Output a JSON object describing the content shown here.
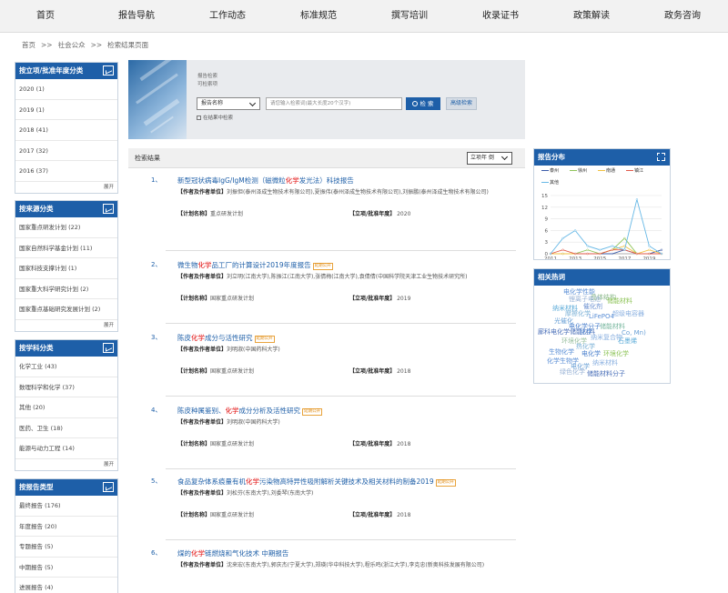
{
  "nav": [
    "首页",
    "报告导航",
    "工作动态",
    "标准规范",
    "撰写培训",
    "收录证书",
    "政策解读",
    "政务咨询"
  ],
  "breadcrumb": [
    "首页",
    ">>",
    "社会公众",
    ">>",
    "检索结果页面"
  ],
  "sidebar": [
    {
      "title": "按立项/批准年度分类",
      "items": [
        "2020 (1)",
        "2019 (1)",
        "2018 (41)",
        "2017 (32)",
        "2016 (37)"
      ],
      "more": "展开"
    },
    {
      "title": "按来源分类",
      "items": [
        "国家重点研发计划 (22)",
        "国家自然科学基金计划 (11)",
        "国家科技支撑计划 (1)",
        "国家重大科学研究计划 (2)",
        "国家重点基础研究发展计划 (2)"
      ],
      "more": "展开"
    },
    {
      "title": "按学科分类",
      "items": [
        "化学工业 (43)",
        "数理科学和化学 (37)",
        "其他 (20)",
        "医药、卫生 (18)",
        "能源与动力工程 (14)"
      ],
      "more": "展开"
    },
    {
      "title": "按报告类型",
      "items": [
        "最终报告 (176)",
        "年度报告 (20)",
        "专题报告 (5)",
        "中期报告 (5)",
        "进展报告 (4)"
      ],
      "more": ""
    }
  ],
  "search": {
    "label1": "报告检索",
    "label2": "可检索项",
    "field_select": "报告名称",
    "placeholder": "请您输入检索词(最大长度20个汉字)",
    "search_button": "检 索",
    "advanced_button": "高级检索",
    "in_results": "在结果中检索"
  },
  "results_header": {
    "title": "检索结果",
    "sort": "立项年 倒"
  },
  "results": [
    {
      "num": "1、",
      "title_parts": [
        {
          "t": "新型冠状病毒IgG/IgM检测（磁微粒"
        },
        {
          "t": "化学",
          "hl": true
        },
        {
          "t": "发光法）科技报告"
        }
      ],
      "tag": "",
      "author_label": "【作者及作者单位】",
      "authors": "刘振但(泰州泽成生物技术有限公司),夏振伟(泰州泽成生物技术有限公司),刘振鹏(泰州泽成生物技术有限公司)",
      "plan_label": "【计划名称】",
      "plan": "重点研发计划",
      "year_label": "【立项/批准年度】",
      "year": "2020"
    },
    {
      "num": "2、",
      "title_parts": [
        {
          "t": "微生物"
        },
        {
          "t": "化学",
          "hl": true
        },
        {
          "t": "品工厂的计算设计2019年度报告"
        }
      ],
      "tag": "延期公开",
      "author_label": "【作者及作者单位】",
      "authors": "刘立明(江南大学),陈振江(江南大学),张倩梅(江南大学),袁倩倩(中国科学院天津工业生物技术研究所)",
      "plan_label": "【计划名称】",
      "plan": "国家重点研发计划",
      "year_label": "【立项/批准年度】",
      "year": "2019"
    },
    {
      "num": "3、",
      "title_parts": [
        {
          "t": "陈皮"
        },
        {
          "t": "化学",
          "hl": true
        },
        {
          "t": "成分与活性研究"
        }
      ],
      "tag": "延期公开",
      "author_label": "【作者及作者单位】",
      "authors": "刘明淑(中国药科大学)",
      "plan_label": "【计划名称】",
      "plan": "国家重点研发计划",
      "year_label": "【立项/批准年度】",
      "year": "2018"
    },
    {
      "num": "4、",
      "title_parts": [
        {
          "t": "陈皮种属鉴别、"
        },
        {
          "t": "化学",
          "hl": true
        },
        {
          "t": "成分分析及活性研究"
        }
      ],
      "tag": "延期公开",
      "author_label": "【作者及作者单位】",
      "authors": "刘明淑(中国药科大学)",
      "plan_label": "【计划名称】",
      "plan": "国家重点研发计划",
      "year_label": "【立项/批准年度】",
      "year": "2018"
    },
    {
      "num": "5、",
      "title_parts": [
        {
          "t": "食品复杂体系痕量有机"
        },
        {
          "t": "化学",
          "hl": true
        },
        {
          "t": "污染物高特异性吸附解析关键技术及相关材料的制备2019"
        }
      ],
      "tag": "延期公开",
      "author_label": "【作者及作者单位】",
      "authors": "刘松芬(东南大学),刘委琴(东南大学)",
      "plan_label": "【计划名称】",
      "plan": "国家重点研发计划",
      "year_label": "【立项/批准年度】",
      "year": "2018"
    },
    {
      "num": "6、",
      "title_parts": [
        {
          "t": "煤的"
        },
        {
          "t": "化学",
          "hl": true
        },
        {
          "t": "链燃烧和气化技术 中期报告"
        }
      ],
      "tag": "",
      "author_label": "【作者及作者单位】",
      "authors": "沈来宏(东南大学),郭庆杰(宁夏大学),郑瑛(华中科技大学),程乐鸣(浙江大学),李克忠(新奥科技发展有限公司)",
      "plan_label": "",
      "plan": "",
      "year_label": "",
      "year": ""
    }
  ],
  "report_dist": {
    "title": "报告分布",
    "legend": [
      {
        "name": "泰州",
        "color": "#3b5ba9"
      },
      {
        "name": "徐州",
        "color": "#8fc45a"
      },
      {
        "name": "南通",
        "color": "#f0c040"
      },
      {
        "name": "镇江",
        "color": "#e05a4a"
      },
      {
        "name": "其他",
        "color": "#66b8e6"
      }
    ]
  },
  "chart_data": {
    "type": "line",
    "x": [
      2011,
      2012,
      2013,
      2014,
      2015,
      2016,
      2017,
      2018,
      2019,
      2020
    ],
    "x_tick_labels": [
      "2011",
      "2013",
      "2015",
      "2017",
      "2019"
    ],
    "y_ticks": [
      0,
      3,
      6,
      9,
      12,
      15
    ],
    "ylim": [
      0,
      15
    ],
    "series": [
      {
        "name": "泰州",
        "color": "#3b5ba9",
        "values": [
          0,
          0,
          0,
          0,
          0,
          0,
          1,
          0,
          0,
          1
        ]
      },
      {
        "name": "徐州",
        "color": "#8fc45a",
        "values": [
          0,
          0,
          0,
          1,
          0,
          1,
          4,
          0,
          0,
          0
        ]
      },
      {
        "name": "南通",
        "color": "#f0c040",
        "values": [
          0,
          0,
          0,
          0,
          0,
          1,
          2,
          0,
          1,
          0
        ]
      },
      {
        "name": "镇江",
        "color": "#e05a4a",
        "values": [
          0,
          1,
          0,
          0,
          0,
          1,
          1,
          0,
          0,
          0
        ]
      },
      {
        "name": "其他",
        "color": "#66b8e6",
        "values": [
          0,
          4,
          6,
          2,
          1,
          2,
          1,
          14,
          2,
          0
        ]
      }
    ]
  },
  "hot_words": {
    "title": "相关热词",
    "words": [
      {
        "t": "电化学性能",
        "c": "#5b8fd6"
      },
      {
        "t": "晶体结构",
        "c": "#8ab88a"
      },
      {
        "t": "锂离子电池",
        "c": "#9ab3d6"
      },
      {
        "t": "储能材料",
        "c": "#8fc45a"
      },
      {
        "t": "催化剂",
        "c": "#6a8fd0"
      },
      {
        "t": "纳米材料",
        "c": "#5aaad8"
      },
      {
        "t": "摩擦化学",
        "c": "#7ab0d6"
      },
      {
        "t": "超级电容器",
        "c": "#8ab0e0"
      },
      {
        "t": "LiFePO4",
        "c": "#5b8fd6"
      },
      {
        "t": "光催化",
        "c": "#6aa0d6"
      },
      {
        "t": "电化学分子",
        "c": "#4a7fcc"
      },
      {
        "t": "储能材料",
        "c": "#7ab8a0"
      },
      {
        "t": "廊科电化学储能材料",
        "c": "#4a6fb8"
      },
      {
        "t": "化学",
        "c": "#5b8fd6"
      },
      {
        "t": "Co, Mn)",
        "c": "#6aa0d6"
      },
      {
        "t": "纳米复合物",
        "c": "#8ab0e0"
      },
      {
        "t": "环境化学",
        "c": "#9ac0a0"
      },
      {
        "t": "石墨烯",
        "c": "#5aaad8"
      },
      {
        "t": "热化学",
        "c": "#7ab0d6"
      },
      {
        "t": "生物化学",
        "c": "#5b8fd6"
      },
      {
        "t": "电化学",
        "c": "#4a7fcc"
      },
      {
        "t": "环境化学",
        "c": "#8fc45a"
      },
      {
        "t": "化学生物学",
        "c": "#5b8fd6"
      },
      {
        "t": "电化学",
        "c": "#6aa0d6"
      },
      {
        "t": "纳米材料",
        "c": "#8ab0e0"
      },
      {
        "t": "绿色化学",
        "c": "#9ab3d6"
      },
      {
        "t": "储能材料分子",
        "c": "#4a6fb8"
      }
    ]
  }
}
